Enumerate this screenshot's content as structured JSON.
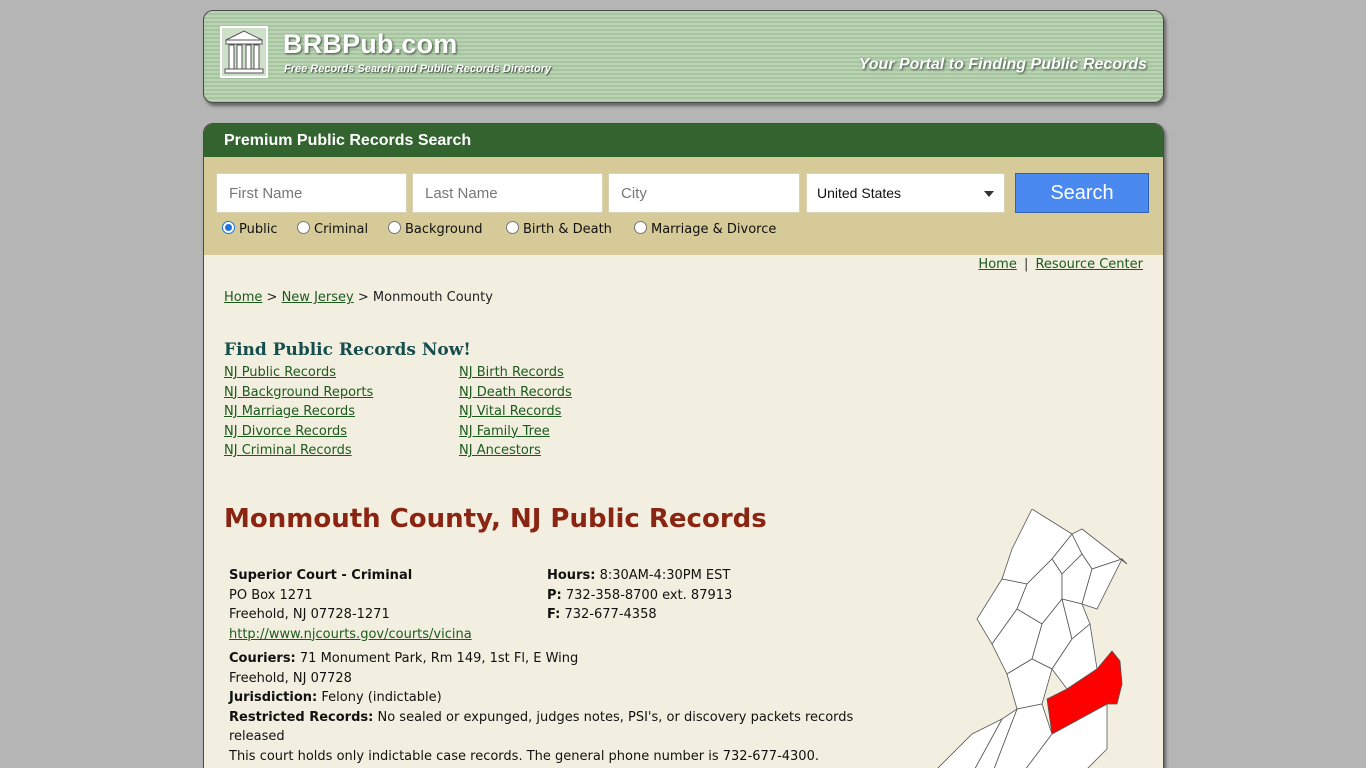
{
  "header": {
    "site_name": "BRBPub.com",
    "site_subtitle": "Free Records Search and Public Records Directory",
    "tagline": "Your Portal to Finding Public Records"
  },
  "search": {
    "panel_title": "Premium Public Records Search",
    "first_name_placeholder": "First Name",
    "last_name_placeholder": "Last Name",
    "city_placeholder": "City",
    "country_selected": "United States",
    "search_button": "Search",
    "radios": [
      {
        "label": "Public",
        "checked": true
      },
      {
        "label": "Criminal",
        "checked": false
      },
      {
        "label": "Background",
        "checked": false
      },
      {
        "label": "Birth & Death",
        "checked": false
      },
      {
        "label": "Marriage & Divorce",
        "checked": false
      }
    ]
  },
  "toplinks": {
    "home": "Home",
    "separator": "|",
    "resource": "Resource Center"
  },
  "breadcrumb": {
    "home": "Home",
    "sep": ">",
    "state": "New Jersey",
    "current": "Monmouth County"
  },
  "find": {
    "title": "Find Public Records Now!",
    "col1": [
      "NJ Public Records",
      "NJ Background Reports",
      "NJ Marriage Records",
      "NJ Divorce Records",
      "NJ Criminal Records"
    ],
    "col2": [
      "NJ Birth Records",
      "NJ Death Records",
      "NJ Vital Records",
      "NJ Family Tree",
      "NJ Ancestors"
    ]
  },
  "county": {
    "title": "Monmouth County, NJ Public Records",
    "office": "Superior Court - Criminal",
    "address1": "PO Box 1271",
    "address2": "Freehold, NJ 07728-1271",
    "url": "http://www.njcourts.gov/courts/vicina",
    "hours_label": "Hours:",
    "hours": "8:30AM-4:30PM EST",
    "phone_label": "P:",
    "phone": "732-358-8700 ext. 87913",
    "fax_label": "F:",
    "fax": "732-677-4358",
    "couriers_label": "Couriers:",
    "couriers1": "71 Monument Park, Rm 149, 1st Fl, E Wing",
    "couriers2": "Freehold, NJ 07728",
    "jurisdiction_label": "Jurisdiction:",
    "jurisdiction": "Felony (indictable)",
    "restricted_label": "Restricted Records:",
    "restricted1": "No sealed or expunged, judges notes, PSI's, or discovery packets records",
    "restricted2": "released",
    "note": "This court holds only indictable case records. The general phone number is 732-677-4300."
  },
  "colors": {
    "green_bar": "#33632f",
    "tan": "#d6cb98",
    "title_red": "#8a2413",
    "highlight": "#ff0000"
  }
}
